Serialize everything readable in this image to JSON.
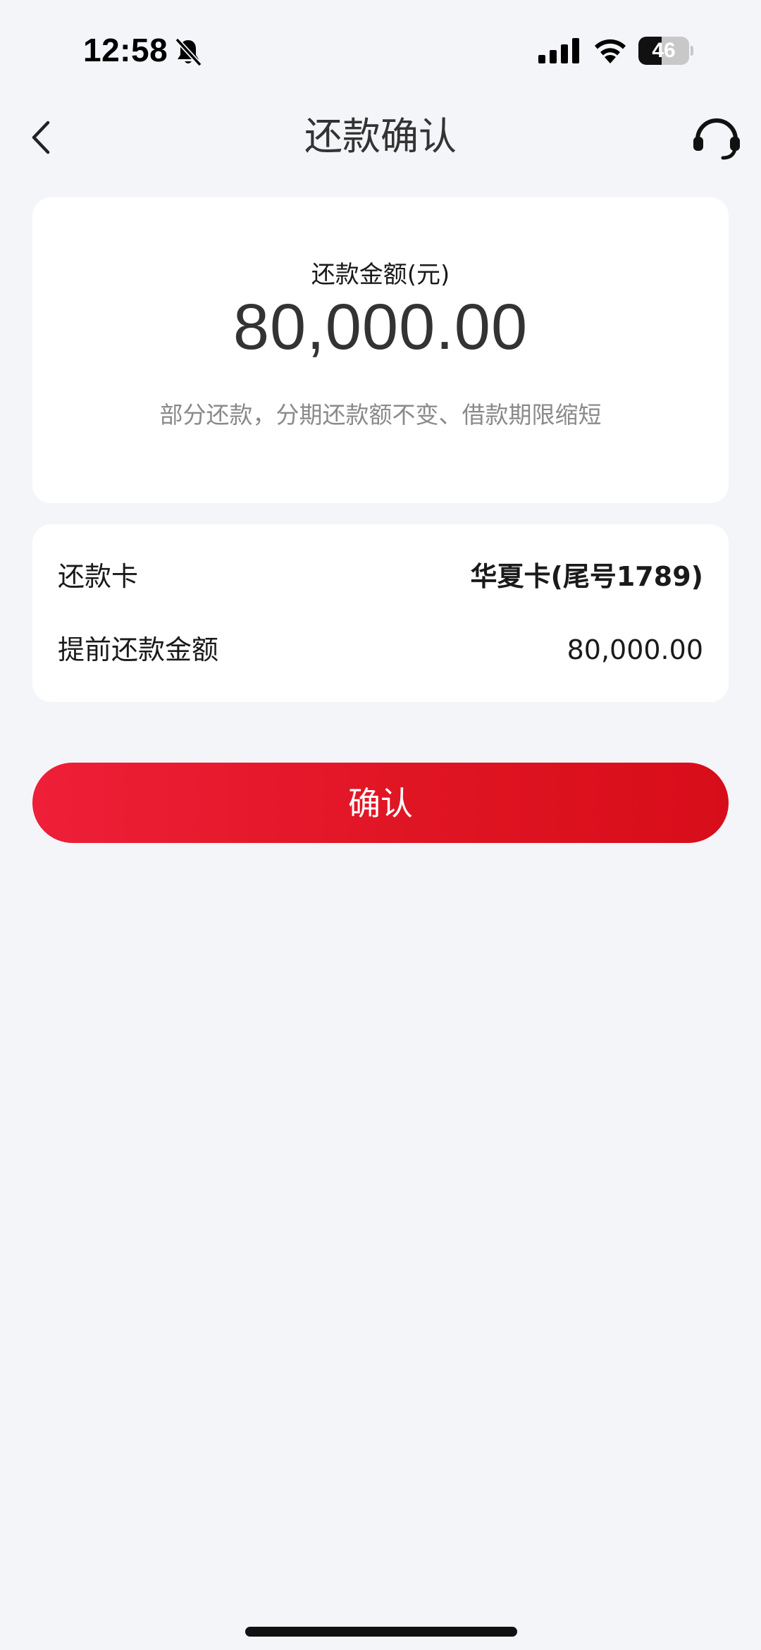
{
  "status_bar": {
    "time": "12:58",
    "battery_level": "46",
    "icons": [
      "bell-slash-icon",
      "cellular-signal-icon",
      "wifi-icon",
      "battery-icon"
    ]
  },
  "nav": {
    "title": "还款确认",
    "back_icon": "chevron-left-icon",
    "service_icon": "headset-icon"
  },
  "amount_card": {
    "label": "还款金额(元)",
    "amount": "80,000.00",
    "description": "部分还款，分期还款额不变、借款期限缩短"
  },
  "details": [
    {
      "label": "还款卡",
      "value": "华夏卡(尾号1789)"
    },
    {
      "label": "提前还款金额",
      "value": "80,000.00"
    }
  ],
  "confirm_button": {
    "label": "确认"
  },
  "colors": {
    "background": "#f4f5f9",
    "card": "#ffffff",
    "accent_red": "#e8192c",
    "secondary_text": "#8a8a8a"
  }
}
